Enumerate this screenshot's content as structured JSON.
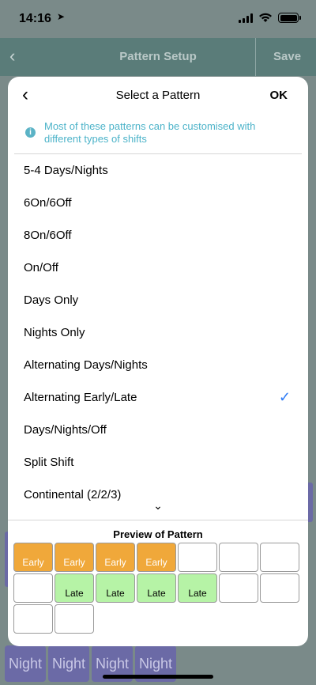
{
  "status_bar": {
    "time": "14:16",
    "location_arrow": "location-arrow-icon"
  },
  "app_header": {
    "back": "‹",
    "title": "Pattern Setup",
    "save": "Save"
  },
  "sheet": {
    "back": "‹",
    "title": "Select a Pattern",
    "ok": "OK",
    "info": "Most of these patterns can be customised with different types of shifts",
    "items": [
      "5-4 Days/Nights",
      "6On/6Off",
      "8On/6Off",
      "On/Off",
      "Days Only",
      "Nights Only",
      "Alternating Days/Nights",
      "Alternating Early/Late",
      "Days/Nights/Off",
      "Split Shift",
      "Continental (2/2/3)"
    ],
    "selected_index": 7,
    "check": "✓",
    "more_chevron": "⌄"
  },
  "preview": {
    "title": "Preview of Pattern",
    "cells": [
      "Early",
      "Early",
      "Early",
      "Early",
      "",
      "",
      "",
      "",
      "Late",
      "Late",
      "Late",
      "Late",
      "",
      "",
      "",
      ""
    ]
  },
  "background": {
    "night_cells": [
      "Night",
      "Night",
      "Night",
      "Night"
    ]
  },
  "colors": {
    "early": "#f0a83a",
    "late": "#b6f3a6",
    "info": "#4cb3c9",
    "check": "#2f7cf6"
  }
}
